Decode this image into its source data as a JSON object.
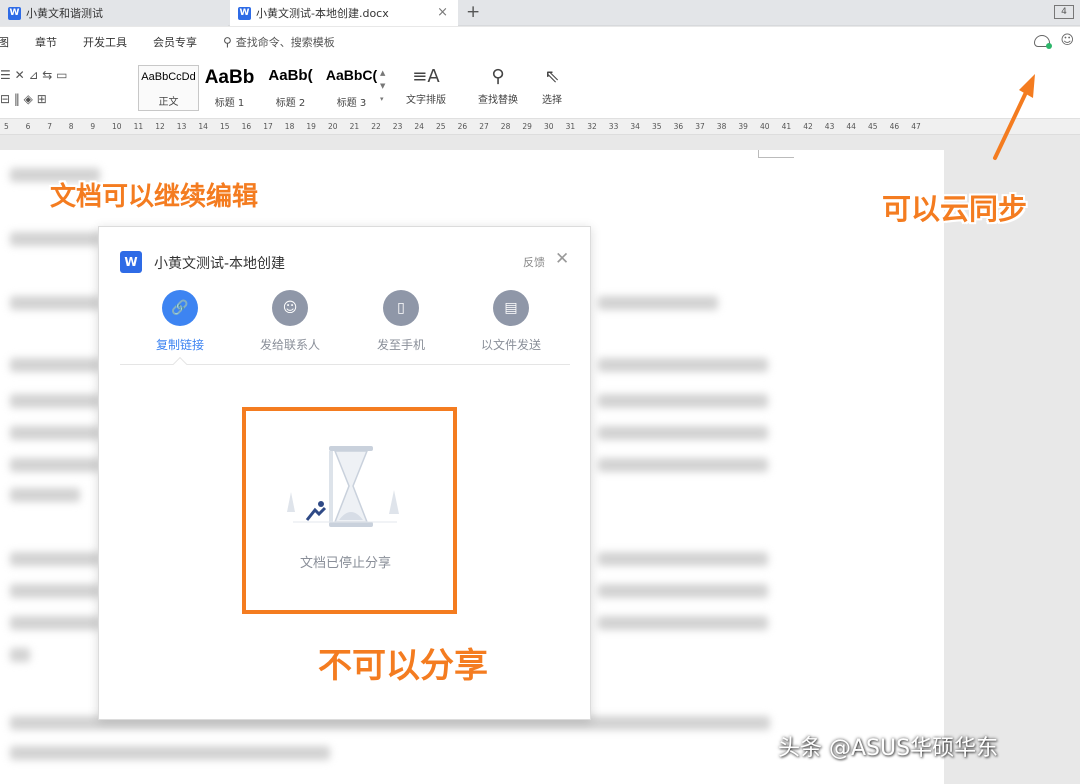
{
  "tabs": [
    {
      "label": "小黄文和谐测试"
    },
    {
      "label": "小黄文测试-本地创建.docx"
    }
  ],
  "tab_add": "+",
  "tab_close": "×",
  "window_badge": "4",
  "menu": {
    "items": [
      "图",
      "章节",
      "开发工具",
      "会员专享"
    ],
    "search_placeholder": "查找命令、搜索模板"
  },
  "ribbon": {
    "styles": [
      {
        "sample": "AaBbCcDd",
        "label": "正文"
      },
      {
        "sample": "AaBb",
        "label": "标题 1"
      },
      {
        "sample": "AaBb(",
        "label": "标题 2"
      },
      {
        "sample": "AaBbC(",
        "label": "标题 3"
      }
    ],
    "text_layout": "文字排版",
    "find_replace": "查找替换",
    "select": "选择"
  },
  "ruler_numbers": [
    "5",
    "6",
    "7",
    "8",
    "9",
    "10",
    "11",
    "12",
    "13",
    "14",
    "15",
    "16",
    "17",
    "18",
    "19",
    "20",
    "21",
    "22",
    "23",
    "24",
    "25",
    "26",
    "27",
    "28",
    "29",
    "30",
    "31",
    "32",
    "33",
    "34",
    "35",
    "36",
    "37",
    "38",
    "39",
    "40",
    "41",
    "42",
    "43",
    "44",
    "45",
    "46",
    "47"
  ],
  "dialog": {
    "title": "小黄文测试-本地创建",
    "feedback": "反馈",
    "options": [
      {
        "label": "复制链接",
        "icon": "link-icon",
        "active": true
      },
      {
        "label": "发给联系人",
        "icon": "contact-icon",
        "active": false
      },
      {
        "label": "发至手机",
        "icon": "phone-icon",
        "active": false
      },
      {
        "label": "以文件发送",
        "icon": "file-icon",
        "active": false
      }
    ],
    "status": "文档已停止分享"
  },
  "annotations": {
    "editable": "文档可以继续编辑",
    "cloud_sync": "可以云同步",
    "no_share": "不可以分享"
  },
  "watermark": "头条 @ASUS华硕华东",
  "colors": {
    "accent": "#3d84f2",
    "annotation": "#f47c20",
    "wps_blue": "#2e6be6"
  }
}
